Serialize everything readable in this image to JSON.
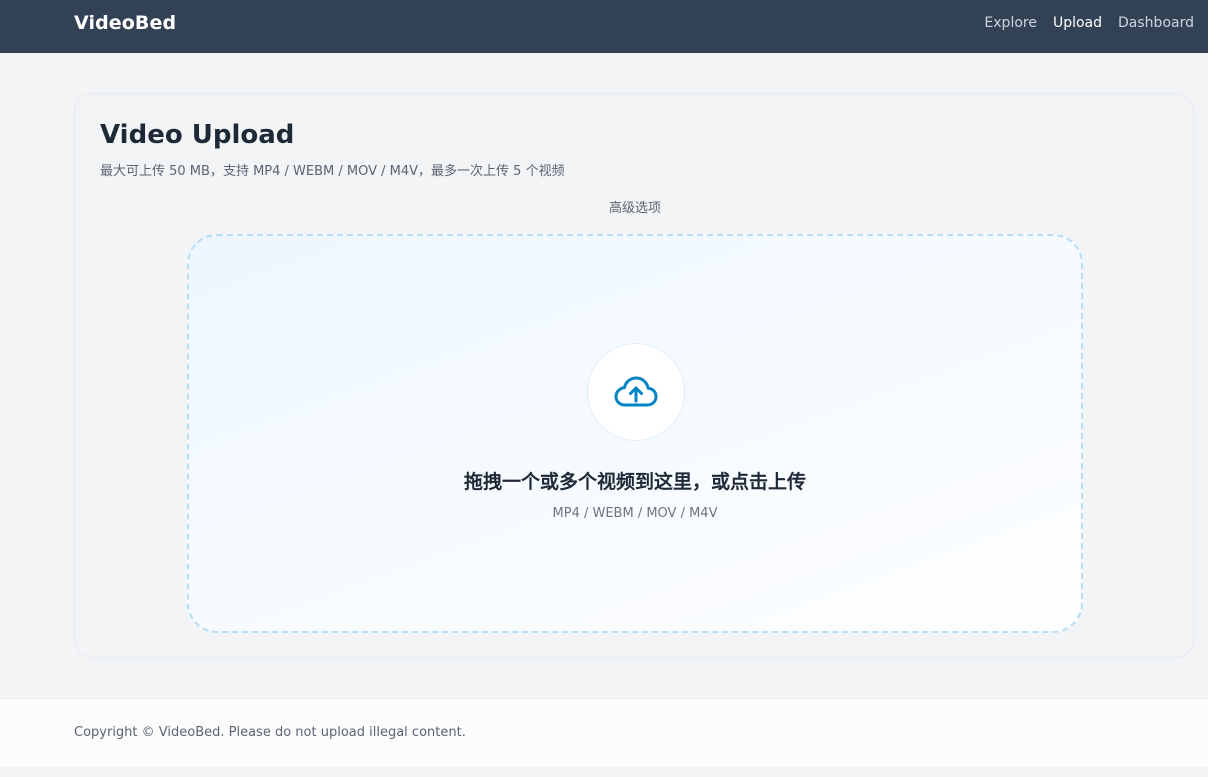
{
  "header": {
    "brand": "VideoBed",
    "nav": [
      {
        "label": "Explore"
      },
      {
        "label": "Upload"
      },
      {
        "label": "Dashboard"
      }
    ]
  },
  "upload": {
    "title": "Video Upload",
    "subtitle": "最大可上传 50 MB，支持 MP4 / WEBM / MOV / M4V，最多一次上传 5 个视频",
    "advanced_label": "高级选项",
    "dropzone": {
      "icon": "cloud-upload-icon",
      "title": "拖拽一个或多个视频到这里，或点击上传",
      "formats": "MP4 / WEBM / MOV / M4V"
    }
  },
  "footer": {
    "text": "Copyright © VideoBed. Please do not upload illegal content."
  },
  "colors": {
    "header_bg": "#334155",
    "accent": "#0284c7",
    "page_bg": "#f3f4f6"
  }
}
